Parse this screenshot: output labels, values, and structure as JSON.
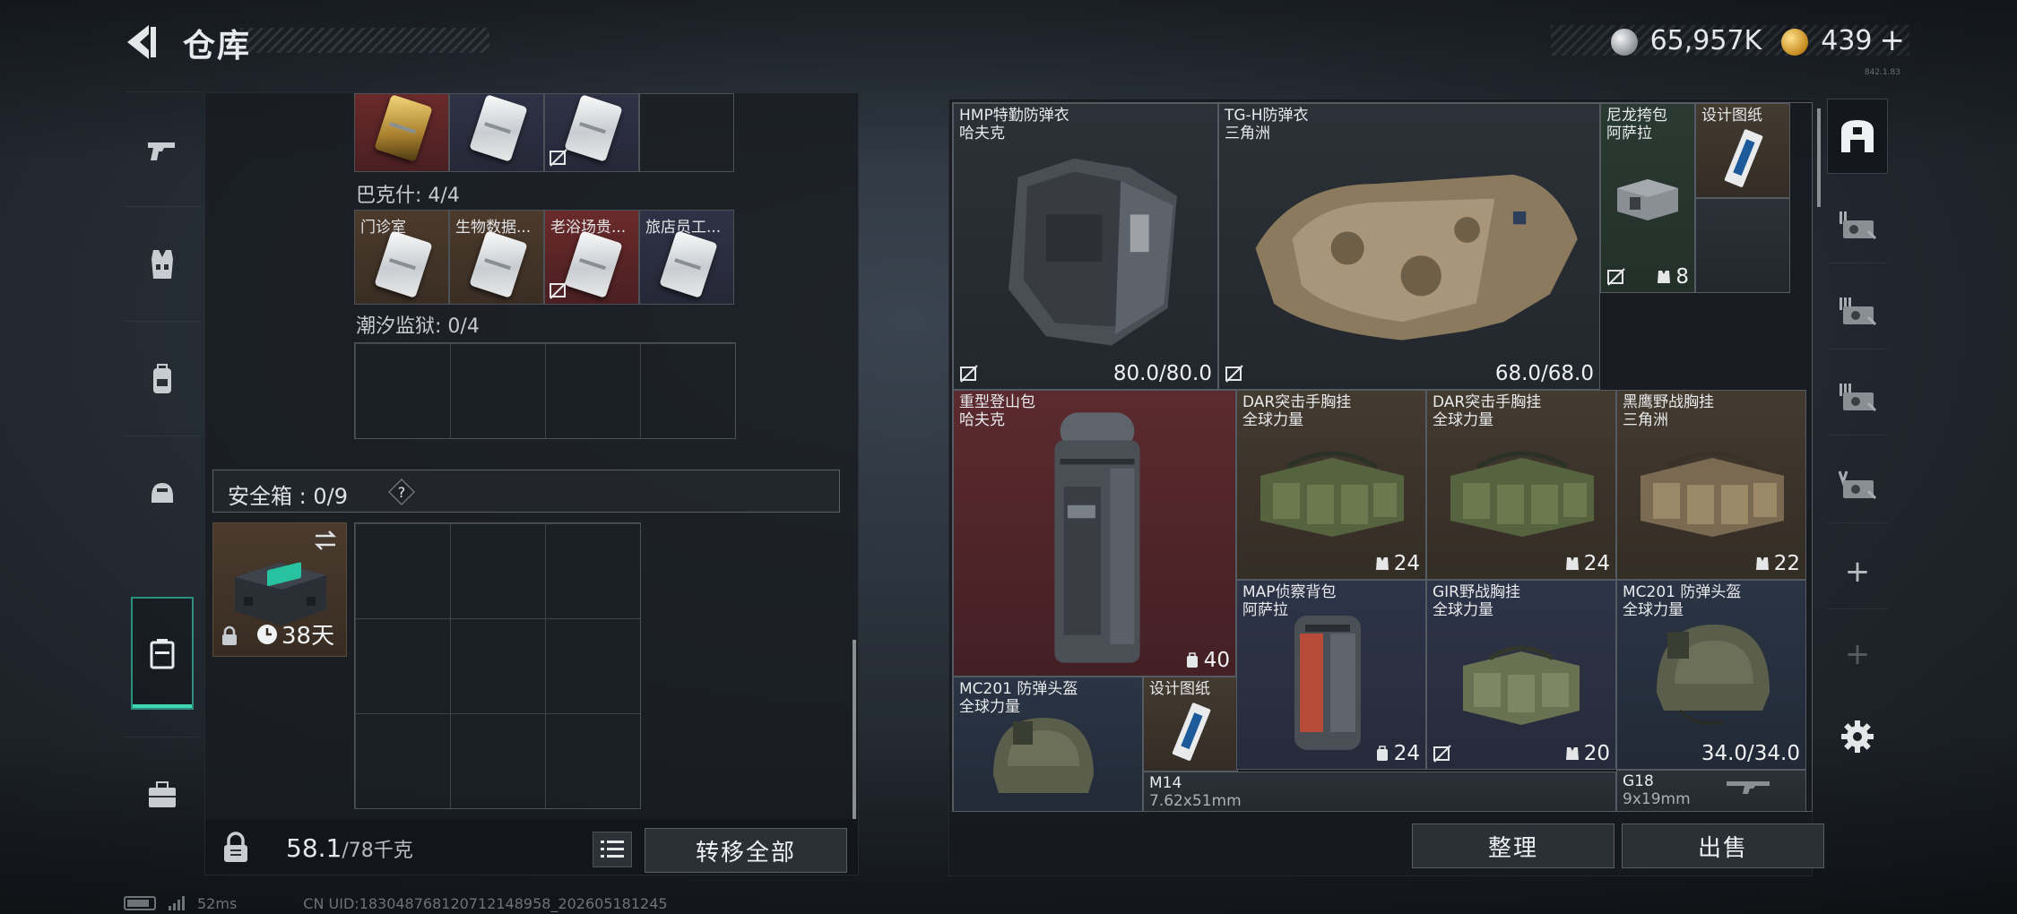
{
  "header": {
    "title": "仓库",
    "currency_silver": "65,957K",
    "currency_gold": "439",
    "gold_plus": "+",
    "version": "842.1.83"
  },
  "left_nav": {
    "items": [
      "pistol-icon",
      "vest-icon",
      "backpack-icon",
      "helmet-icon",
      "safe-box-icon",
      "briefcase-icon"
    ],
    "active_index": 4
  },
  "keycards": {
    "row1": [
      {
        "label": "",
        "tier": "gold",
        "no_sell": false
      },
      {
        "label": "",
        "tier": "silver",
        "no_sell": false
      },
      {
        "label": "",
        "tier": "silver",
        "no_sell": true
      },
      {
        "label": "",
        "tier": "empty",
        "no_sell": false
      }
    ],
    "bakesh_label": "巴克什: 4/4",
    "row2": [
      {
        "label": "门诊室",
        "tier": "brown"
      },
      {
        "label": "生物数据...",
        "tier": "brown"
      },
      {
        "label": "老浴场贵...",
        "tier": "red"
      },
      {
        "label": "旅店员工...",
        "tier": "purple"
      }
    ],
    "tide_label": "潮汐监狱: 0/4"
  },
  "safe_box": {
    "title": "安全箱 : 0/9",
    "help": "?",
    "timer": "38天"
  },
  "bottom": {
    "weight_value": "58.1",
    "weight_max": "/78千克",
    "transfer_label": "转移全部"
  },
  "stash_items": [
    {
      "name": "HMP特勤防弹衣",
      "sub": "哈夫克",
      "durability": "80.0/80.0",
      "rarity": "gray"
    },
    {
      "name": "TG-H防弹衣",
      "sub": "三角洲",
      "durability": "68.0/68.0",
      "rarity": "gray"
    },
    {
      "name": "尼龙挎包",
      "sub": "阿萨拉",
      "capacity": "8",
      "rarity": "green"
    },
    {
      "name": "设计图纸",
      "sub": "",
      "rarity": "brown"
    },
    {
      "name": "重型登山包",
      "sub": "哈夫克",
      "capacity": "40",
      "rarity": "red"
    },
    {
      "name": "DAR突击手胸挂",
      "sub": "全球力量",
      "capacity": "24",
      "rarity": "brown"
    },
    {
      "name": "DAR突击手胸挂",
      "sub": "全球力量",
      "capacity": "24",
      "rarity": "brown"
    },
    {
      "name": "黑鹰野战胸挂",
      "sub": "三角洲",
      "capacity": "22",
      "rarity": "brown"
    },
    {
      "name": "MC201 防弹头盔",
      "sub": "全球力量",
      "rarity": "blue"
    },
    {
      "name": "设计图纸",
      "sub": "",
      "rarity": "brown"
    },
    {
      "name": "MAP侦察背包",
      "sub": "阿萨拉",
      "capacity": "24",
      "rarity": "purple"
    },
    {
      "name": "GIR野战胸挂",
      "sub": "全球力量",
      "capacity": "20",
      "rarity": "purple"
    },
    {
      "name": "MC201 防弹头盔",
      "sub": "全球力量",
      "durability": "34.0/34.0",
      "rarity": "blue"
    },
    {
      "name": "M14",
      "sub": "7.62x51mm",
      "rarity": "gray"
    },
    {
      "name": "G18",
      "sub": "9x19mm",
      "rarity": "gray"
    }
  ],
  "actions": {
    "organize": "整理",
    "sell": "出售"
  },
  "right_nav": {
    "items": [
      "stash-home-icon",
      "stash-tab-1-icon",
      "stash-tab-2-icon",
      "stash-tab-3-icon",
      "stash-tab-5-icon"
    ],
    "add": "+",
    "settings": "gear-icon"
  },
  "status": {
    "ping": "52ms",
    "uid": "CN UID:183048768120712148958_202605181245"
  },
  "colors": {
    "accent_teal": "#3fd6b2",
    "rarity_red": "#5b2a2e",
    "rarity_purple": "#2e3448",
    "rarity_brown": "#433a30",
    "rarity_blue": "#2a3444",
    "rarity_green": "#2a3a32"
  }
}
